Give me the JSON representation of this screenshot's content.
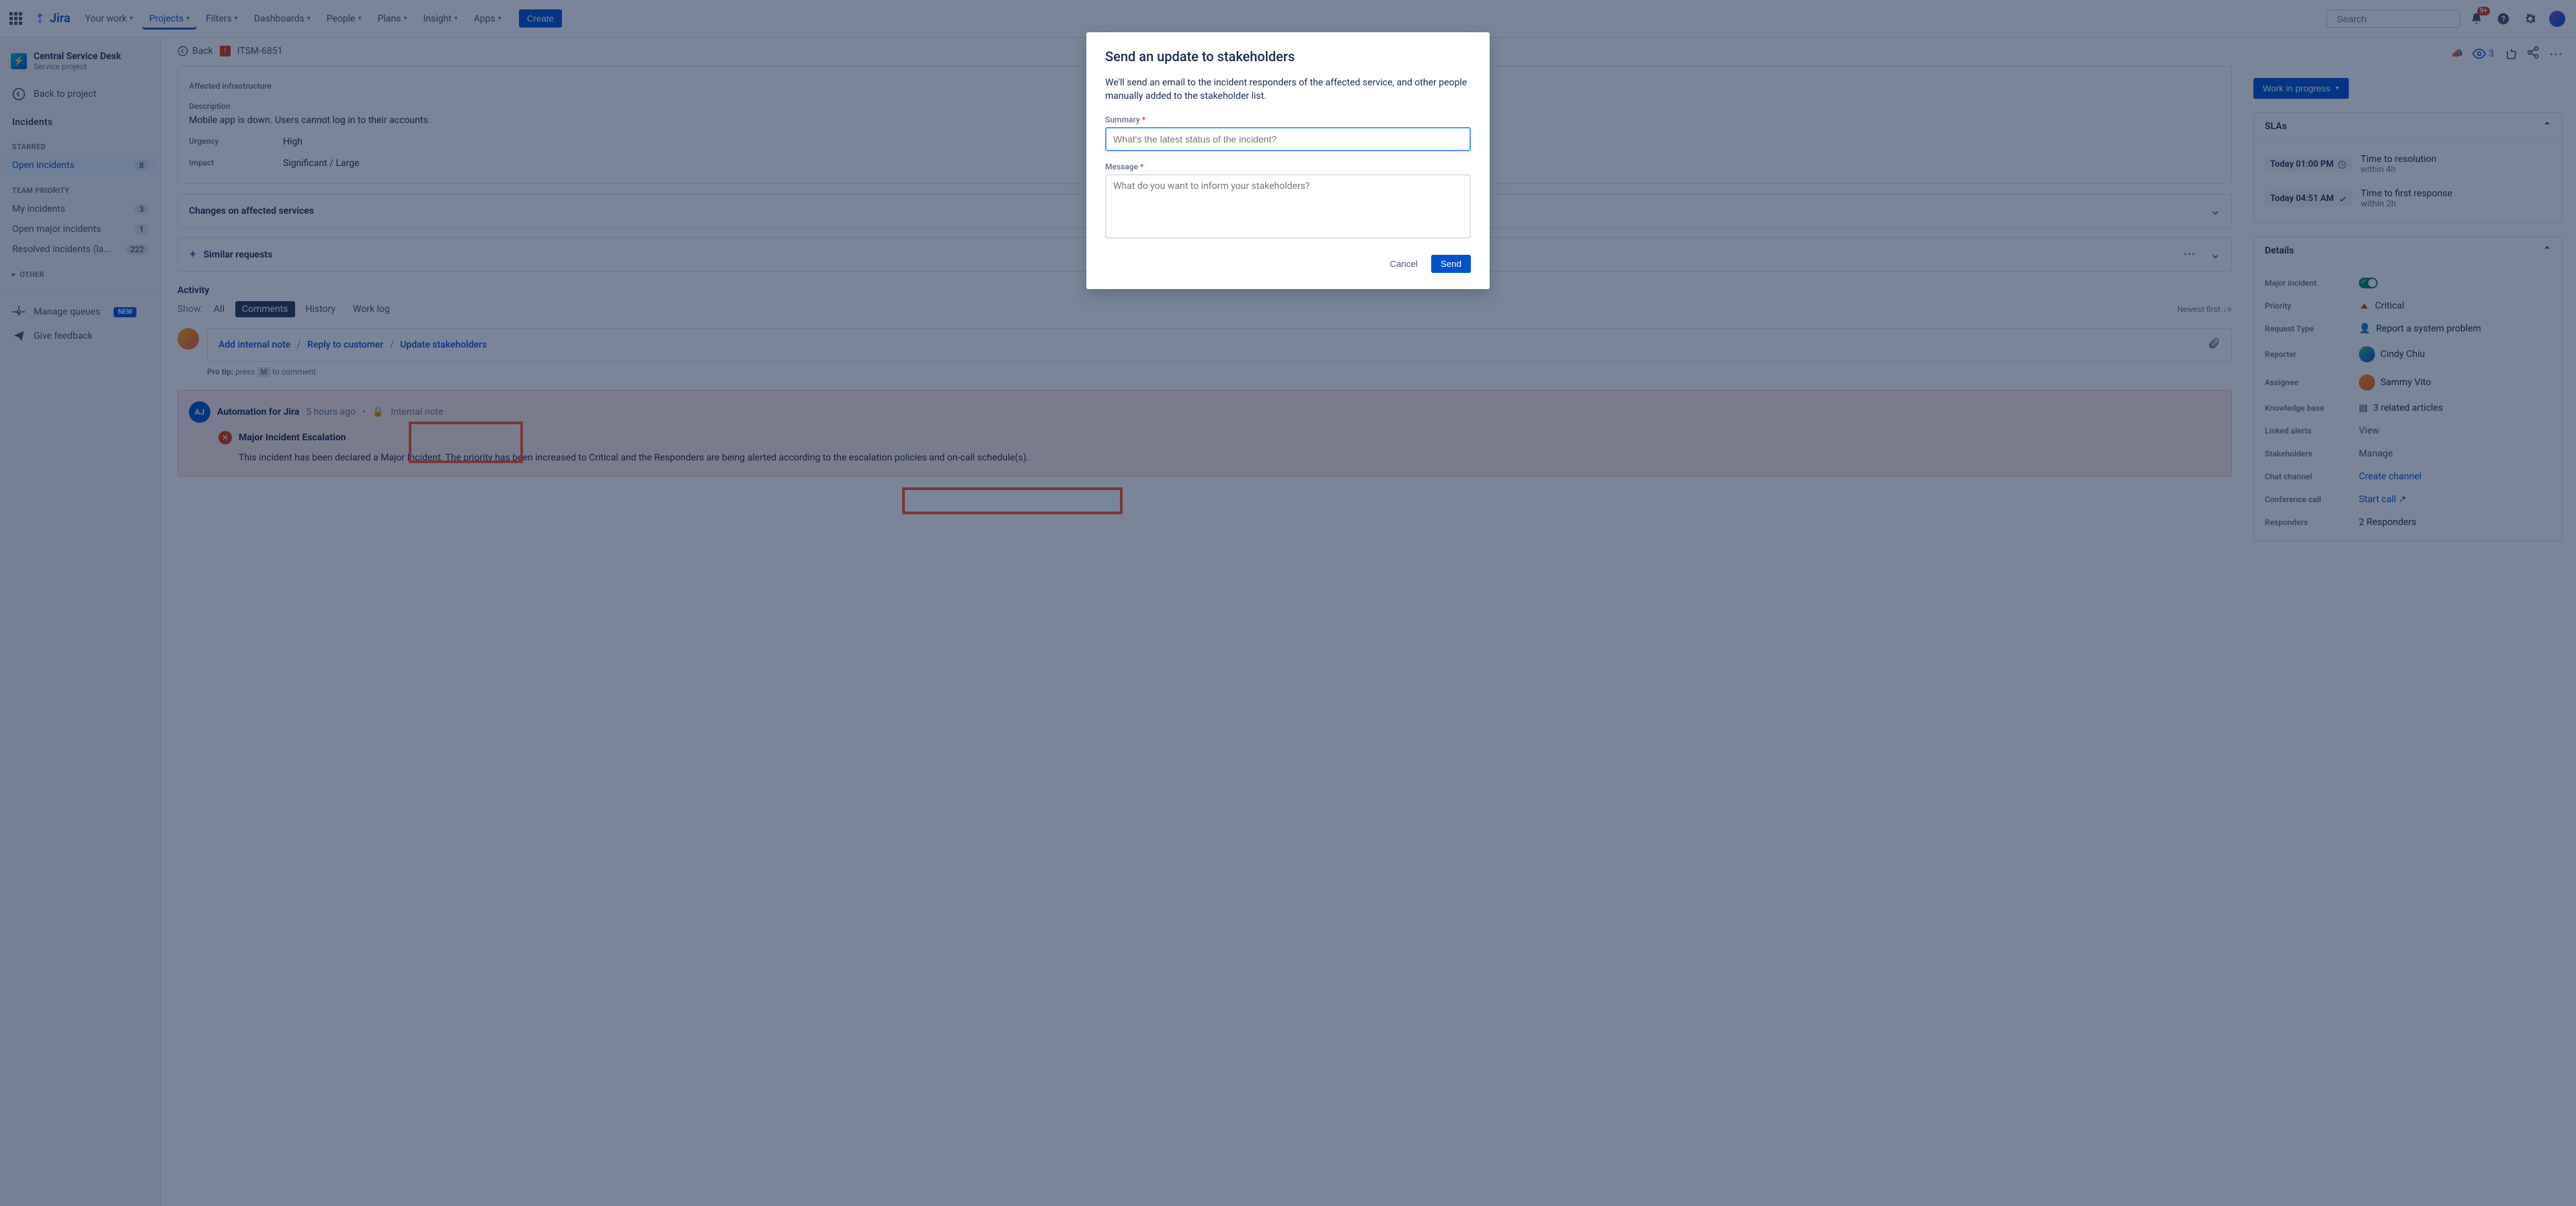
{
  "topnav": {
    "logo": "Jira",
    "items": [
      "Your work",
      "Projects",
      "Filters",
      "Dashboards",
      "People",
      "Plans",
      "Insight",
      "Apps"
    ],
    "create": "Create",
    "search_placeholder": "Search",
    "notif_badge": "9+"
  },
  "sidebar": {
    "project_name": "Central Service Desk",
    "project_type": "Service project",
    "back": "Back to project",
    "section_incidents": "Incidents",
    "starred": "STARRED",
    "open_incidents": {
      "label": "Open incidents",
      "count": "8"
    },
    "team_priority": "TEAM PRIORITY",
    "my_incidents": {
      "label": "My incidents",
      "count": "3"
    },
    "open_major": {
      "label": "Open major incidents",
      "count": "1"
    },
    "resolved": {
      "label": "Resolved incidents (la...",
      "count": "222"
    },
    "other": "OTHER",
    "manage_queues": "Manage queues",
    "new": "NEW",
    "feedback": "Give feedback"
  },
  "crumb": {
    "back": "Back",
    "key": "ITSM-6851"
  },
  "fields": {
    "affected_infra": "Affected infrastructure",
    "description_label": "Description",
    "description": "Mobile app is down. Users cannot log in to their accounts.",
    "urgency_label": "Urgency",
    "urgency": "High",
    "impact_label": "Impact",
    "impact": "Significant / Large"
  },
  "changes_panel": "Changes on affected services",
  "similar_panel": "Similar requests",
  "activity": {
    "title": "Activity",
    "show": "Show:",
    "tabs": [
      "All",
      "Comments",
      "History",
      "Work log"
    ],
    "newest": "Newest first",
    "add_note": "Add internal note",
    "reply": "Reply to customer",
    "update": "Update stakeholders",
    "protip_label": "Pro tip:",
    "protip_1": "press",
    "protip_key": "M",
    "protip_2": "to comment"
  },
  "escalation": {
    "author": "Automation for Jira",
    "time": "5 hours ago",
    "note_type": "Internal note",
    "title": "Major Incident Escalation",
    "body": "This incident has been declared a Major Incident. The priority has been increased to Critical and the Responders are being alerted according to the escalation policies and on-call schedule(s)."
  },
  "right": {
    "status": "Work in progress",
    "watchers": "3",
    "slas_title": "SLAs",
    "sla1_time": "Today 01:00 PM",
    "sla1_name": "Time to resolution",
    "sla1_within": "within 4h",
    "sla2_time": "Today 04:51 AM",
    "sla2_name": "Time to first response",
    "sla2_within": "within 2h",
    "details_title": "Details",
    "major_label": "Major incident",
    "priority_label": "Priority",
    "priority": "Critical",
    "reqtype_label": "Request Type",
    "reqtype": "Report a system problem",
    "reporter_label": "Reporter",
    "reporter": "Cindy Chiu",
    "assignee_label": "Assignee",
    "assignee": "Sammy Vito",
    "kb_label": "Knowledge base",
    "kb": "3 related articles",
    "alerts_label": "Linked alerts",
    "alerts": "View",
    "stake_label": "Stakeholders",
    "stake": "Manage",
    "chat_label": "Chat channel",
    "chat": "Create channel",
    "conf_label": "Conference call",
    "conf": "Start call",
    "resp_label": "Responders",
    "resp": "2 Responders"
  },
  "modal": {
    "title": "Send an update to stakeholders",
    "intro": "We'll send an email to the incident responders of the affected service, and other people manually added to the stakeholder list.",
    "summary_label": "Summary",
    "summary_placeholder": "What's the latest status of the incident?",
    "message_label": "Message",
    "message_placeholder": "What do you want to inform your stakeholders?",
    "cancel": "Cancel",
    "send": "Send"
  }
}
